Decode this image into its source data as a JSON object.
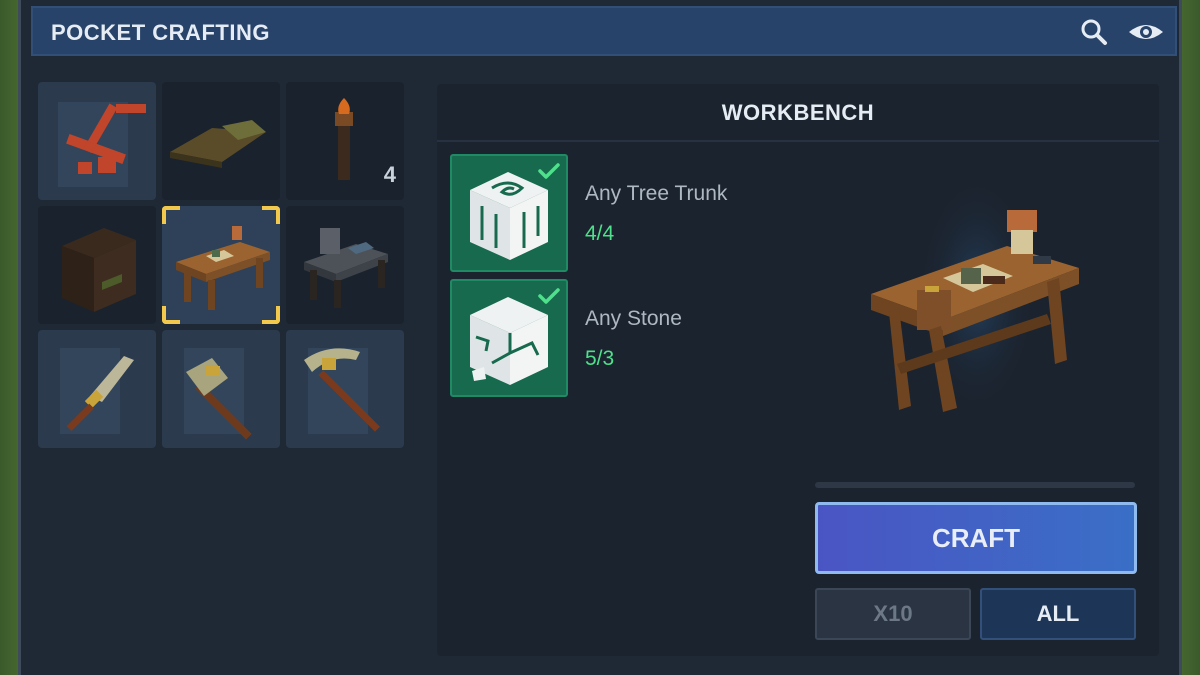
{
  "window": {
    "title": "POCKET CRAFTING"
  },
  "header_icons": [
    "search-icon",
    "eye-icon"
  ],
  "recipes": [
    {
      "name": "catapult",
      "quantity": null,
      "state": "available"
    },
    {
      "name": "plank-floor",
      "quantity": null,
      "state": "unavailable"
    },
    {
      "name": "torch",
      "quantity": "4",
      "state": "unavailable"
    },
    {
      "name": "wooden-chest",
      "quantity": null,
      "state": "unavailable"
    },
    {
      "name": "workbench",
      "quantity": null,
      "state": "selected"
    },
    {
      "name": "anvil-table",
      "quantity": null,
      "state": "unavailable"
    },
    {
      "name": "stone-dagger",
      "quantity": null,
      "state": "available"
    },
    {
      "name": "stone-axe",
      "quantity": null,
      "state": "available"
    },
    {
      "name": "stone-pickaxe",
      "quantity": null,
      "state": "available"
    }
  ],
  "detail": {
    "title": "WORKBENCH",
    "ingredients": [
      {
        "name": "Any Tree Trunk",
        "count": "4/4",
        "icon": "tree-trunk-icon",
        "satisfied": true
      },
      {
        "name": "Any Stone",
        "count": "5/3",
        "icon": "stone-icon",
        "satisfied": true
      }
    ]
  },
  "buttons": {
    "craft": "CRAFT",
    "x10": "X10",
    "all": "ALL"
  },
  "colors": {
    "accent_green": "#4ee08a",
    "selected_corner": "#f2c94c",
    "craft_blue": "#4a55c4"
  }
}
